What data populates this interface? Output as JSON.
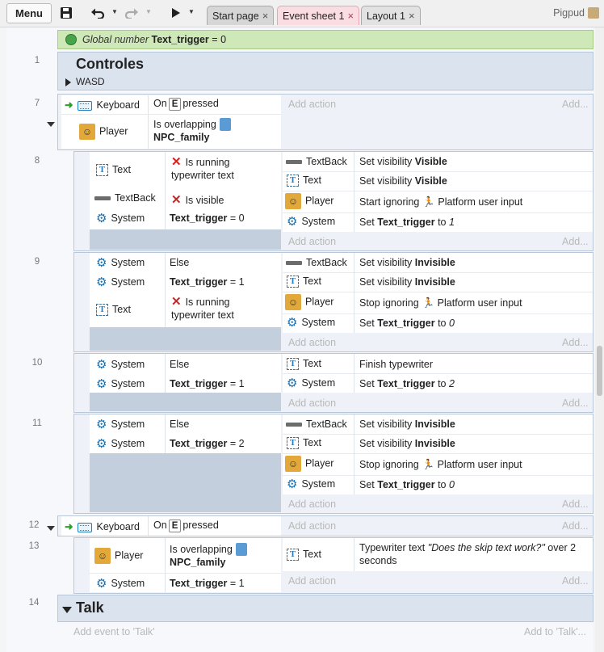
{
  "toolbar": {
    "menu_label": "Menu",
    "icons": [
      "save-icon",
      "undo-icon",
      "redo-icon",
      "play-icon"
    ],
    "tabs": [
      {
        "label": "Start page",
        "active": false
      },
      {
        "label": "Event sheet 1",
        "active": true
      },
      {
        "label": "Layout 1",
        "active": false
      }
    ],
    "close_glyph": "×",
    "user_name": "Pigpud"
  },
  "global_var": {
    "prefix": "Global number",
    "name": "Text_trigger",
    "value": "= 0"
  },
  "group_controles": {
    "line": "1",
    "title": "Controles",
    "description": "WASD"
  },
  "event7": {
    "line": "7",
    "cond1": {
      "object": "Keyboard",
      "on": "On",
      "key": "E",
      "suffix": "pressed"
    },
    "cond2": {
      "object": "Player",
      "text": "Is overlapping",
      "target": "NPC_family"
    },
    "add_action": "Add action",
    "add": "Add..."
  },
  "event8": {
    "line": "8",
    "conds": [
      {
        "object": "Text",
        "text1": "Is running",
        "text2": "typewriter text"
      },
      {
        "object": "TextBack",
        "text1": "Is visible"
      },
      {
        "object": "System",
        "var": "Text_trigger",
        "op": "= 0"
      }
    ],
    "actions": [
      {
        "object": "TextBack",
        "verb": "Set visibility",
        "value": "Visible"
      },
      {
        "object": "Text",
        "verb": "Set visibility",
        "value": "Visible"
      },
      {
        "object": "Player",
        "verb": "Start ignoring",
        "value": "Platform user input"
      },
      {
        "object": "System",
        "verb": "Set",
        "var": "Text_trigger",
        "to": "to",
        "value": "1"
      }
    ],
    "add_action": "Add action",
    "add": "Add..."
  },
  "event9": {
    "line": "9",
    "conds": [
      {
        "object": "System",
        "text1": "Else"
      },
      {
        "object": "System",
        "var": "Text_trigger",
        "op": "= 1"
      },
      {
        "object": "Text",
        "text1": "Is running",
        "text2": "typewriter text"
      }
    ],
    "actions": [
      {
        "object": "TextBack",
        "verb": "Set visibility",
        "value": "Invisible"
      },
      {
        "object": "Text",
        "verb": "Set visibility",
        "value": "Invisible"
      },
      {
        "object": "Player",
        "verb": "Stop ignoring",
        "value": "Platform user input"
      },
      {
        "object": "System",
        "verb": "Set",
        "var": "Text_trigger",
        "to": "to",
        "value": "0"
      }
    ],
    "add_action": "Add action",
    "add": "Add..."
  },
  "event10": {
    "line": "10",
    "conds": [
      {
        "object": "System",
        "text1": "Else"
      },
      {
        "object": "System",
        "var": "Text_trigger",
        "op": "= 1"
      }
    ],
    "actions": [
      {
        "object": "Text",
        "verb": "Finish typewriter"
      },
      {
        "object": "System",
        "verb": "Set",
        "var": "Text_trigger",
        "to": "to",
        "value": "2"
      }
    ],
    "add_action": "Add action",
    "add": "Add..."
  },
  "event11": {
    "line": "11",
    "conds": [
      {
        "object": "System",
        "text1": "Else"
      },
      {
        "object": "System",
        "var": "Text_trigger",
        "op": "= 2"
      }
    ],
    "actions": [
      {
        "object": "TextBack",
        "verb": "Set visibility",
        "value": "Invisible"
      },
      {
        "object": "Text",
        "verb": "Set visibility",
        "value": "Invisible"
      },
      {
        "object": "Player",
        "verb": "Stop ignoring",
        "value": "Platform user input"
      },
      {
        "object": "System",
        "verb": "Set",
        "var": "Text_trigger",
        "to": "to",
        "value": "0"
      }
    ],
    "add_action": "Add action",
    "add": "Add..."
  },
  "event12": {
    "line": "12",
    "cond1": {
      "object": "Keyboard",
      "on": "On",
      "key": "E",
      "suffix": "pressed"
    },
    "add_action": "Add action",
    "add": "Add..."
  },
  "event13": {
    "line": "13",
    "conds": [
      {
        "object": "Player",
        "text1": "Is overlapping",
        "target": "NPC_family"
      },
      {
        "object": "System",
        "var": "Text_trigger",
        "op": "= 1"
      }
    ],
    "actions": [
      {
        "object": "Text",
        "verb": "Typewriter text",
        "quote": "\"Does the skip text work?\"",
        "over": "over 2",
        "unit": "seconds"
      }
    ],
    "add_action": "Add action",
    "add": "Add..."
  },
  "group_talk": {
    "line": "14",
    "title": "Talk"
  },
  "footer": {
    "add_event": "Add event to 'Talk'",
    "add_to": "Add to 'Talk'..."
  }
}
